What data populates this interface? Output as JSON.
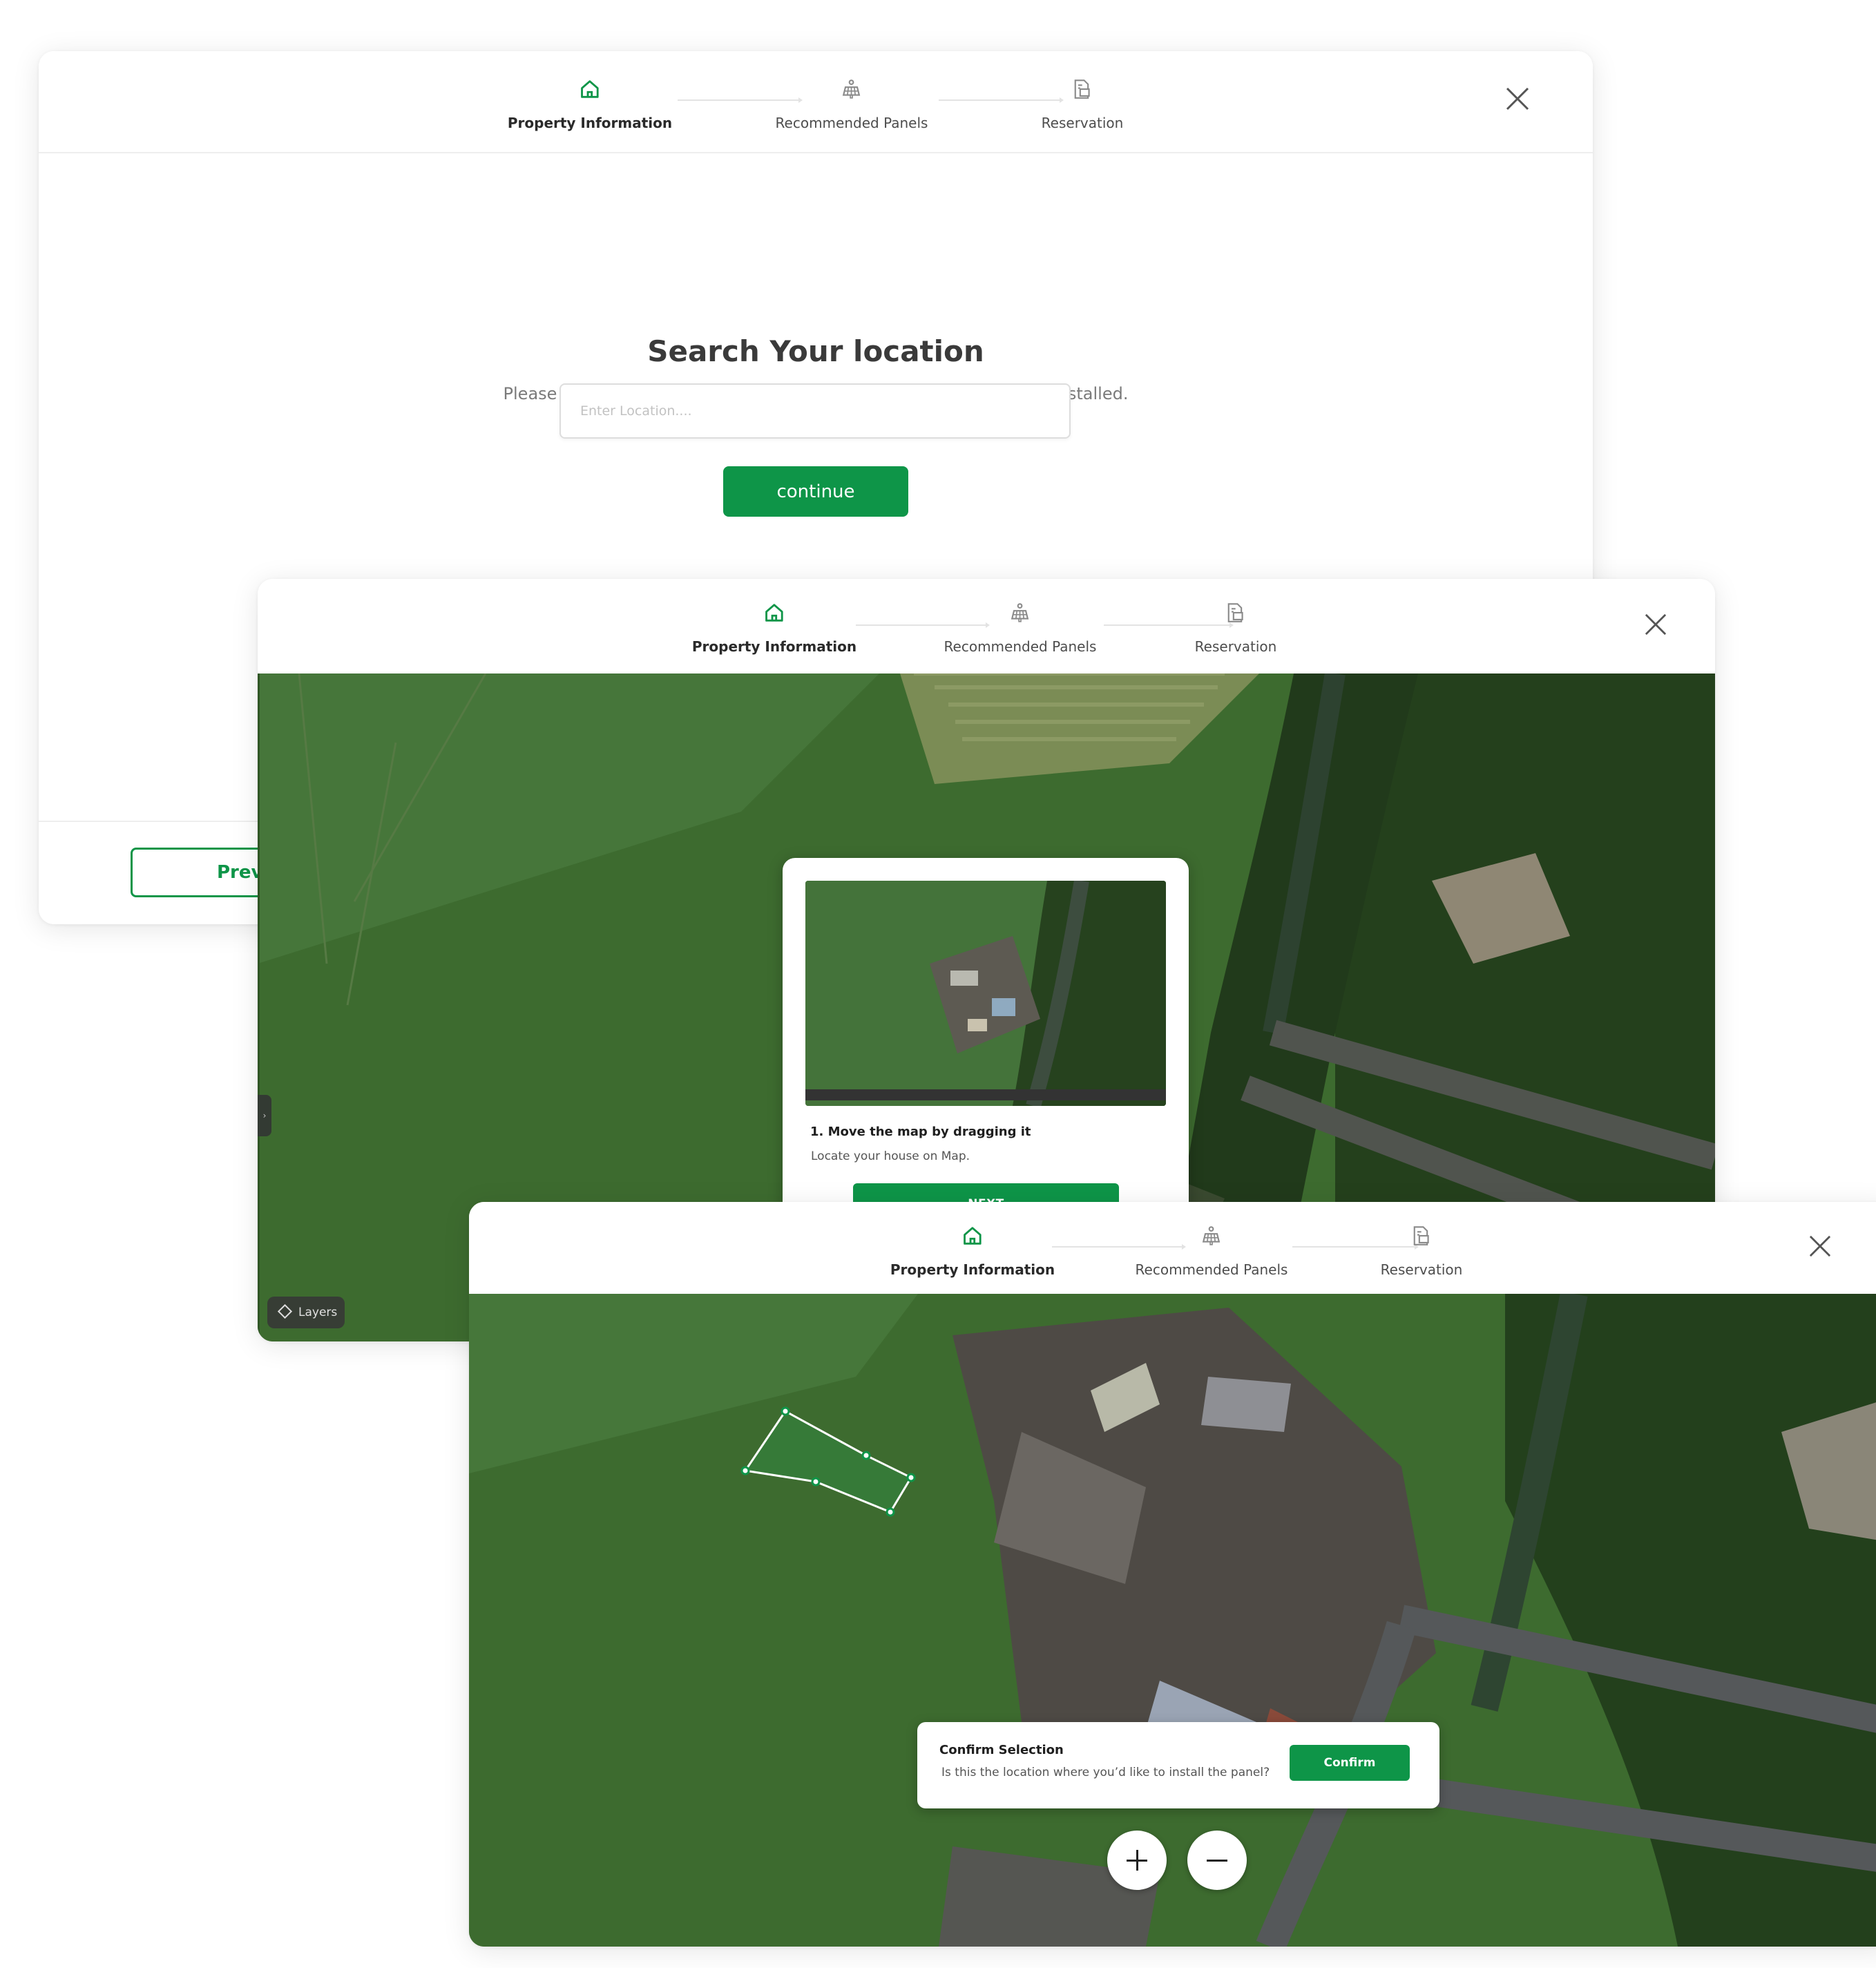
{
  "steps": [
    {
      "label": "Property Information",
      "icon": "home-icon",
      "active": true
    },
    {
      "label": "Recommended Panels",
      "icon": "solar-panel-icon",
      "active": false
    },
    {
      "label": "Reservation",
      "icon": "reservation-document-icon",
      "active": false
    }
  ],
  "search_screen": {
    "title": "Search Your location",
    "subtitle": "Please enter the location where you’d like your solar panels to be installed.",
    "input_placeholder": "Enter Location....",
    "input_value": "",
    "continue_label": "continue",
    "previous_label": "Previ"
  },
  "map_tour_screen": {
    "tour_title": "1. Move the map by dragging it",
    "tour_description": "Locate your house on Map.",
    "next_label": "NEXT",
    "layers_label": "Layers"
  },
  "confirm_screen": {
    "confirm_title": "Confirm Selection",
    "confirm_description": "Is this the location where you’d like to install the panel?",
    "confirm_label": "Confirm",
    "zoom_in_icon": "plus-icon",
    "zoom_out_icon": "minus-icon"
  },
  "colors": {
    "brand_green": "#0e9548",
    "step_inactive": "#8a8a8a",
    "map_field": "#3a6a2c",
    "selection_outline": "#ffffff"
  }
}
